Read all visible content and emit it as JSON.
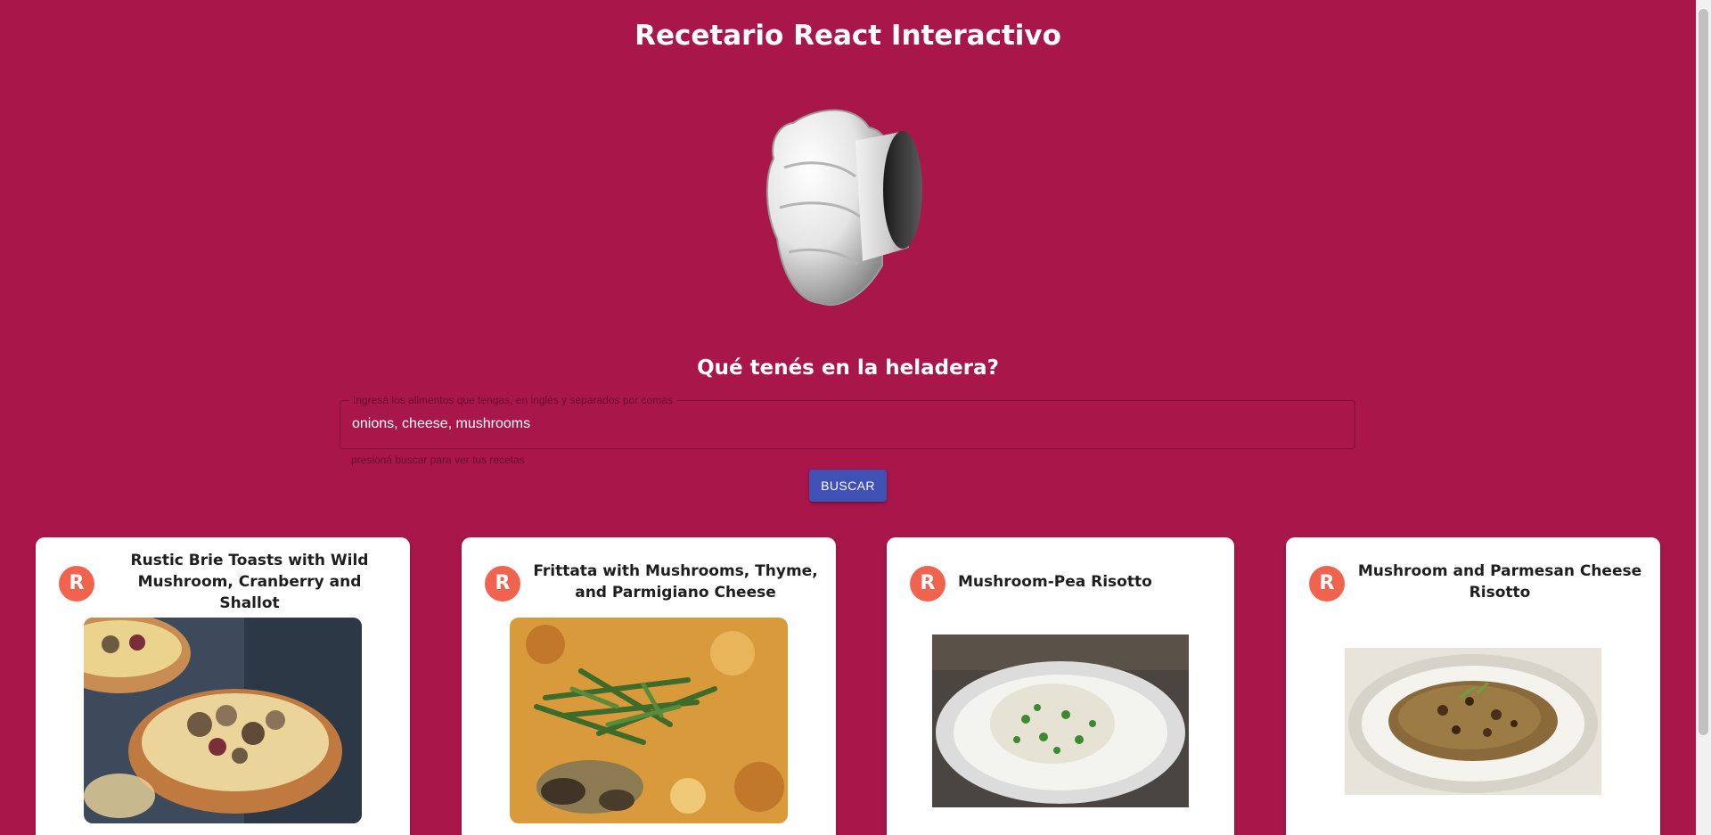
{
  "app": {
    "title": "Recetario React Interactivo"
  },
  "search": {
    "heading": "Qué tenés en la heladera?",
    "label": "Ingresá los alimentos que tengas, en inglés y separados por comas",
    "value": "onions, cheese, mushrooms",
    "helper": "presioná buscar para ver tus recetas",
    "button_label": "BUSCAR"
  },
  "recipes": [
    {
      "avatar": "R",
      "title": "Rustic Brie Toasts with Wild Mushroom, Cranberry and Shallot"
    },
    {
      "avatar": "R",
      "title": "Frittata with Mushrooms, Thyme, and Parmigiano Cheese"
    },
    {
      "avatar": "R",
      "title": "Mushroom-Pea Risotto"
    },
    {
      "avatar": "R",
      "title": "Mushroom and Parmesan Cheese Risotto"
    }
  ],
  "colors": {
    "background": "#a8164a",
    "button": "#3f51b5",
    "avatar": "#f0634f"
  }
}
